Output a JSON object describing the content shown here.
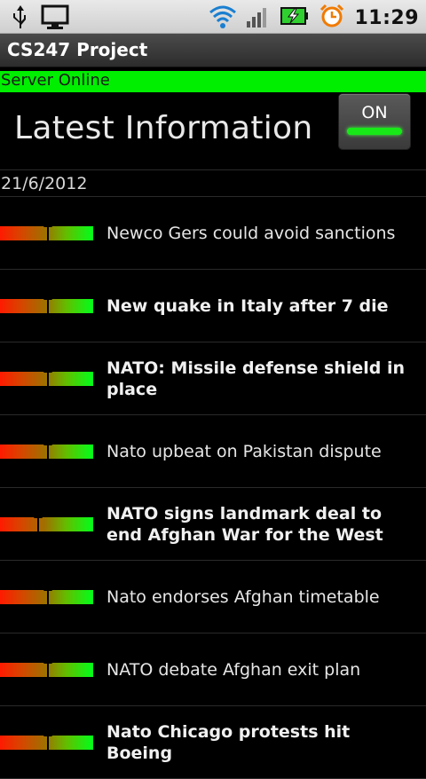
{
  "status_bar": {
    "time": "11:29",
    "icons": [
      "usb-icon",
      "monitor-icon",
      "wifi-icon",
      "signal-icon",
      "battery-charging-icon",
      "alarm-clock-icon"
    ]
  },
  "title_bar": {
    "title": "CS247 Project"
  },
  "server_status": {
    "text": "Server Online",
    "color": "#00ee00"
  },
  "header": {
    "heading": "Latest Information",
    "toggle": {
      "label": "ON",
      "state": "on",
      "indicator_color": "#18e818"
    }
  },
  "date": "21/6/2012",
  "news": [
    {
      "title": "Newco Gers could avoid sanctions",
      "bold": false,
      "sentiment": 0.5
    },
    {
      "title": "New quake in Italy after 7 die",
      "bold": true,
      "sentiment": 0.5
    },
    {
      "title": "NATO: Missile defense shield in place",
      "bold": true,
      "sentiment": 0.5
    },
    {
      "title": "Nato upbeat on Pakistan dispute",
      "bold": false,
      "sentiment": 0.5
    },
    {
      "title": "NATO signs landmark deal to end Afghan War for the West",
      "bold": true,
      "sentiment": 0.4
    },
    {
      "title": "Nato endorses Afghan timetable",
      "bold": false,
      "sentiment": 0.5
    },
    {
      "title": "NATO debate Afghan exit plan",
      "bold": false,
      "sentiment": 0.5
    },
    {
      "title": "Nato Chicago protests hit Boeing",
      "bold": true,
      "sentiment": 0.5
    }
  ]
}
